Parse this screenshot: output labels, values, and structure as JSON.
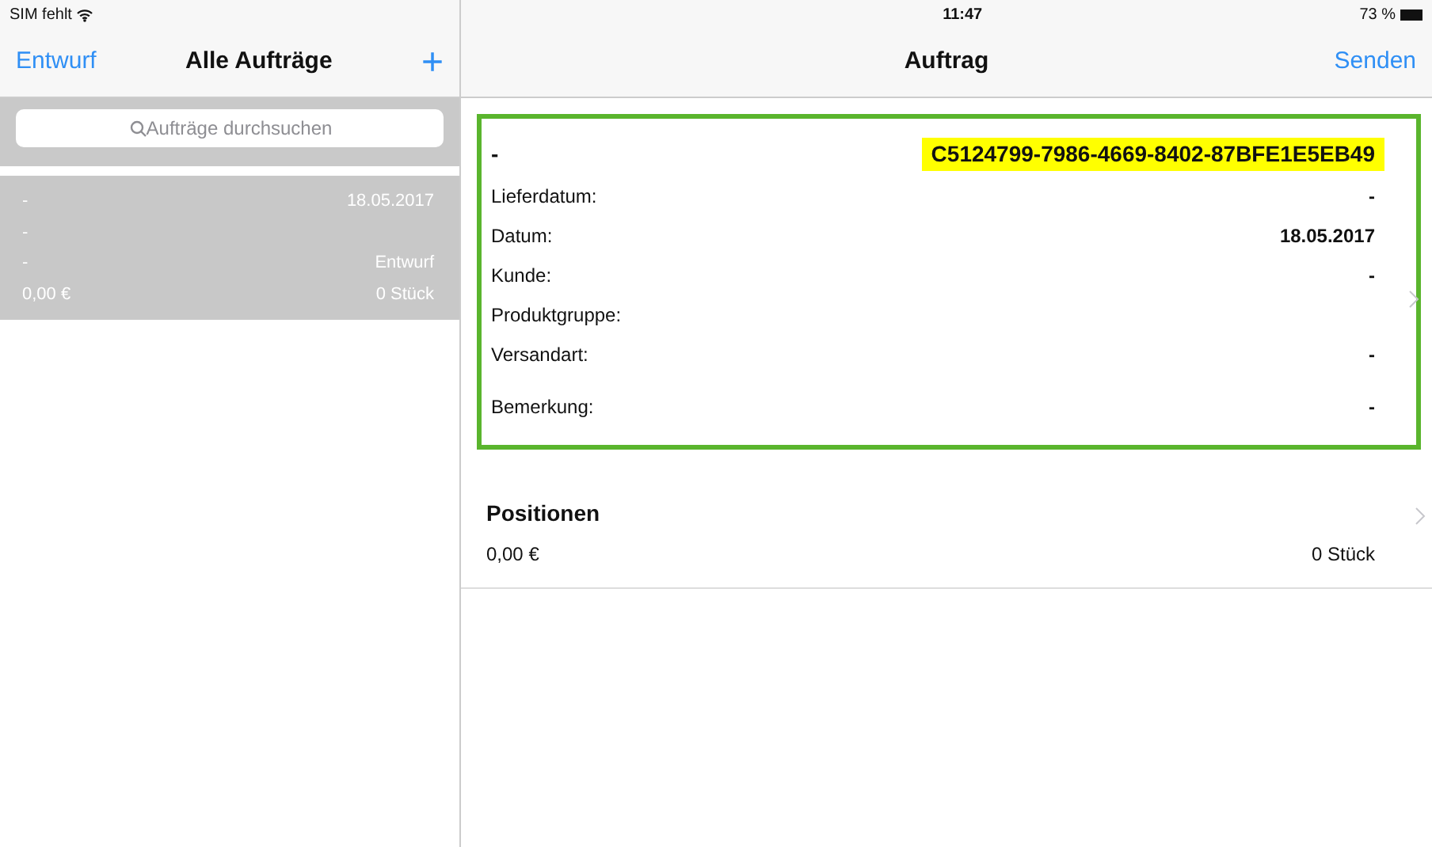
{
  "status_bar": {
    "carrier": "SIM fehlt",
    "time": "11:47",
    "battery": "73 %"
  },
  "sidebar": {
    "left_button": "Entwurf",
    "title": "Alle Aufträge",
    "add_button": "+",
    "search": {
      "placeholder": "Aufträge durchsuchen"
    },
    "orders": [
      {
        "selected": true,
        "title": "-",
        "date": "18.05.2017",
        "line_2": "-",
        "line_3": "-",
        "status": "Entwurf",
        "amount": "0,00 €",
        "count": "0 Stück"
      }
    ]
  },
  "detail": {
    "title": "Auftrag",
    "send_button": "Senden",
    "header": {
      "label": "-",
      "id": "C5124799-7986-4669-8402-87BFE1E5EB49",
      "highlighted": true
    },
    "fields": [
      {
        "label": "Lieferdatum:",
        "value": "-"
      },
      {
        "label": "Datum:",
        "value": "18.05.2017"
      },
      {
        "label": "Kunde:",
        "value": "-"
      },
      {
        "label": "Produktgruppe:"
      },
      {
        "label": "Versandart:",
        "value": "-"
      },
      {
        "label": "Bemerkung:",
        "value": "-"
      }
    ],
    "positions": {
      "title": "Positionen",
      "amount": "0,00 €",
      "count": "0 Stück"
    }
  }
}
